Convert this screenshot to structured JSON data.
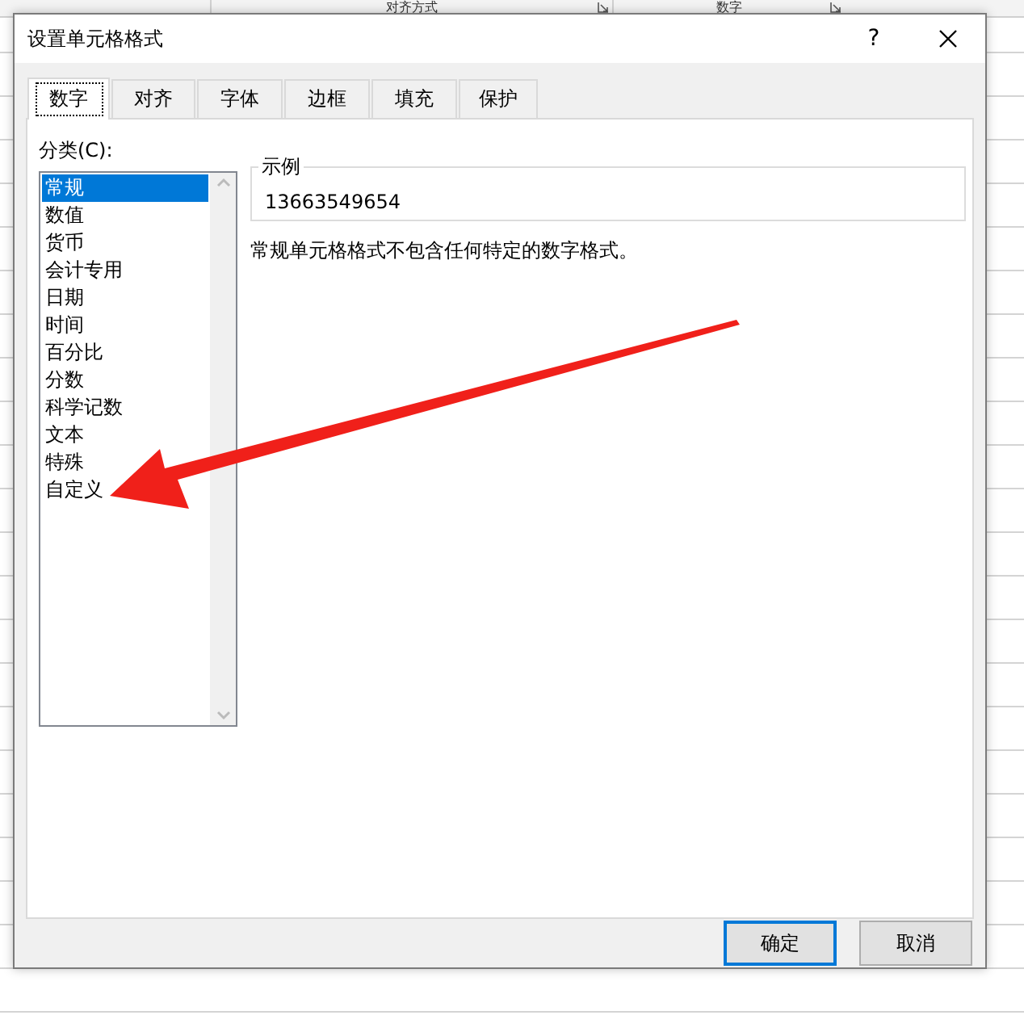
{
  "ribbon": {
    "groups": [
      "对齐方式",
      "数字"
    ]
  },
  "window": {
    "title": "设置单元格格式",
    "help": "?"
  },
  "tabs": [
    {
      "label": "数字",
      "selected": true
    },
    {
      "label": "对齐",
      "selected": false
    },
    {
      "label": "字体",
      "selected": false
    },
    {
      "label": "边框",
      "selected": false
    },
    {
      "label": "填充",
      "selected": false
    },
    {
      "label": "保护",
      "selected": false
    }
  ],
  "category": {
    "label": "分类(C):",
    "items": [
      {
        "label": "常规",
        "selected": true
      },
      {
        "label": "数值",
        "selected": false
      },
      {
        "label": "货币",
        "selected": false
      },
      {
        "label": "会计专用",
        "selected": false
      },
      {
        "label": "日期",
        "selected": false
      },
      {
        "label": "时间",
        "selected": false
      },
      {
        "label": "百分比",
        "selected": false
      },
      {
        "label": "分数",
        "selected": false
      },
      {
        "label": "科学记数",
        "selected": false
      },
      {
        "label": "文本",
        "selected": false
      },
      {
        "label": "特殊",
        "selected": false
      },
      {
        "label": "自定义",
        "selected": false
      }
    ]
  },
  "sample": {
    "label": "示例",
    "value": "13663549654"
  },
  "description": "常规单元格格式不包含任何特定的数字格式。",
  "buttons": [
    {
      "label": "确定",
      "kind": "default"
    },
    {
      "label": "取消",
      "kind": "normal"
    }
  ]
}
